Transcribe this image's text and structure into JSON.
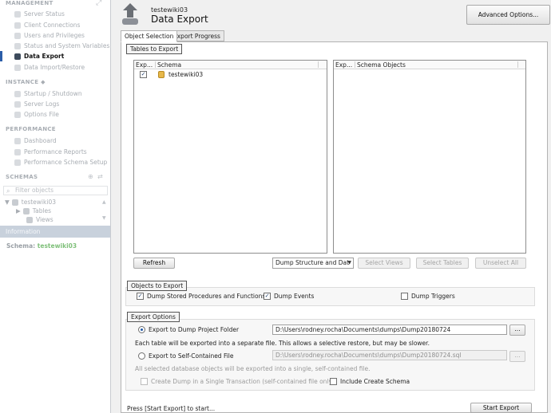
{
  "sidebar": {
    "management": {
      "title": "MANAGEMENT",
      "items": [
        "Server Status",
        "Client Connections",
        "Users and Privileges",
        "Status and System Variables",
        "Data Export",
        "Data Import/Restore"
      ]
    },
    "instance": {
      "title": "INSTANCE",
      "items": [
        "Startup / Shutdown",
        "Server Logs",
        "Options File"
      ]
    },
    "performance": {
      "title": "PERFORMANCE",
      "items": [
        "Dashboard",
        "Performance Reports",
        "Performance Schema Setup"
      ]
    },
    "schemas": {
      "title": "SCHEMAS",
      "filter_placeholder": "Filter objects",
      "tree": {
        "schema": "testewiki03",
        "children": [
          "Tables",
          "Views"
        ]
      }
    },
    "information": {
      "title": "Information",
      "schema_label": "Schema:",
      "schema_value": "testewiki03"
    }
  },
  "header": {
    "subtitle": "testewiki03",
    "title": "Data Export",
    "advanced_button": "Advanced Options..."
  },
  "tabs": [
    "Object Selection",
    "Export Progress"
  ],
  "tables_to_export": {
    "title": "Tables to Export",
    "left_list": {
      "col1": "Exp...",
      "col2": "Schema",
      "rows": [
        {
          "checked": "✓",
          "name": "testewiki03"
        }
      ]
    },
    "right_list": {
      "col1": "Exp...",
      "col2": "Schema Objects"
    },
    "refresh_button": "Refresh",
    "dump_mode": "Dump Structure and Dat",
    "select_views": "Select Views",
    "select_tables": "Select Tables",
    "unselect_all": "Unselect All"
  },
  "objects_to_export": {
    "title": "Objects to Export",
    "stored_procs": {
      "label": "Dump Stored Procedures and Functions",
      "mark": "✓"
    },
    "events": {
      "label": "Dump Events",
      "mark": "✓"
    },
    "triggers": {
      "label": "Dump Triggers",
      "mark": ""
    }
  },
  "export_options": {
    "title": "Export Options",
    "project_folder": {
      "label": "Export to Dump Project Folder",
      "path": "D:\\Users\\rodney.rocha\\Documents\\dumps\\Dump20180724",
      "note": "Each table will be exported into a separate file. This allows a selective restore, but may be slower."
    },
    "self_contained": {
      "label": "Export to Self-Contained File",
      "path": "D:\\Users\\rodney.rocha\\Documents\\dumps\\Dump20180724.sql",
      "note": "All selected database objects will be exported into a single, self-contained file."
    },
    "browse": "...",
    "single_transaction": "Create Dump in a Single Transaction (self-contained file only)",
    "include_schema": "Include Create Schema"
  },
  "footer": {
    "status": "Press [Start Export] to start...",
    "start_button": "Start Export"
  }
}
